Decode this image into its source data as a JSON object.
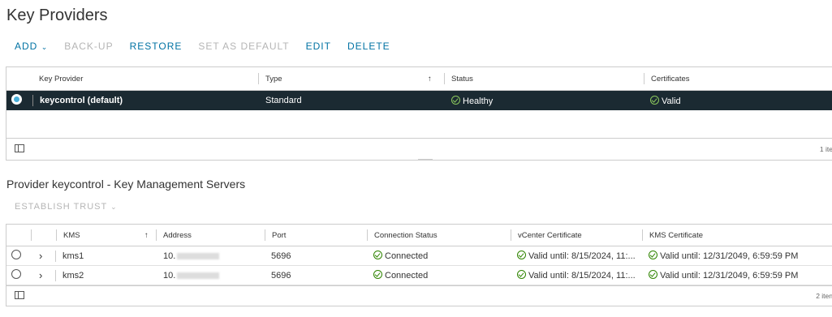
{
  "page": {
    "title": "Key Providers"
  },
  "toolbar": {
    "add": "ADD",
    "add_caret": "⌄",
    "backup": "BACK-UP",
    "restore": "RESTORE",
    "set_default": "SET AS DEFAULT",
    "edit": "EDIT",
    "delete": "DELETE"
  },
  "providers": {
    "headers": {
      "key_provider": "Key Provider",
      "type": "Type",
      "sort_arrow": "↑",
      "status": "Status",
      "certificates": "Certificates"
    },
    "rows": [
      {
        "key_provider": "keycontrol (default)",
        "type": "Standard",
        "status": "Healthy",
        "certificates": "Valid"
      }
    ],
    "footer_count": "1 ite"
  },
  "servers": {
    "title": "Provider keycontrol - Key Management Servers",
    "establish_trust": "ESTABLISH TRUST",
    "trust_caret": "⌄",
    "headers": {
      "kms": "KMS",
      "sort_arrow": "↑",
      "address": "Address",
      "port": "Port",
      "connection_status": "Connection Status",
      "vcenter_certificate": "vCenter Certificate",
      "kms_certificate": "KMS Certificate"
    },
    "rows": [
      {
        "kms": "kms1",
        "address": "10.",
        "port": "5696",
        "connection_status": "Connected",
        "vcenter_certificate": "Valid until: 8/15/2024, 11:...",
        "kms_certificate": "Valid until: 12/31/2049, 6:59:59 PM"
      },
      {
        "kms": "kms2",
        "address": "10.",
        "port": "5696",
        "connection_status": "Connected",
        "vcenter_certificate": "Valid until: 8/15/2024, 11:...",
        "kms_certificate": "Valid until: 12/31/2049, 6:59:59 PM"
      }
    ],
    "footer_count": "2 iten"
  },
  "colors": {
    "accent": "#0072a3",
    "selected_row": "#1b2a32",
    "ok": "#2f8400",
    "radio_selected": "#49afd9"
  },
  "icons": {
    "expand": "chevron-right-icon",
    "columns": "column-toggle-icon",
    "status": "check-circle-icon"
  }
}
